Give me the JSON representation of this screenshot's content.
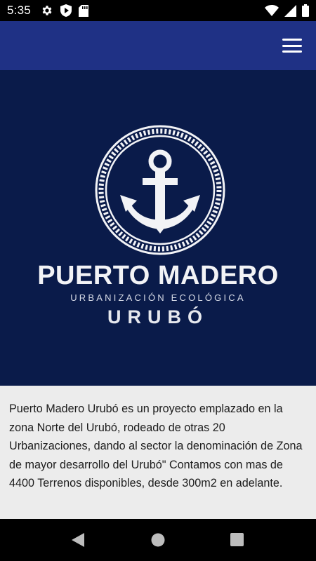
{
  "status_bar": {
    "time": "5:35",
    "left_icons": [
      "gear-icon",
      "play-protect-icon",
      "sd-card-icon"
    ],
    "right_icons": [
      "wifi-icon",
      "cell-signal-icon",
      "battery-icon"
    ]
  },
  "app_bar": {
    "menu_icon": "hamburger-menu-icon",
    "background": "#1f3185"
  },
  "hero": {
    "background": "#0a1b4a",
    "logo_icon": "anchor-icon",
    "title": "PUERTO MADERO",
    "subtitle": "URBANIZACIÓN ECOLÓGICA",
    "place": "URUBÓ"
  },
  "description": {
    "text": "Puerto Madero Urubó es un proyecto emplazado en la zona Norte del Urubó, rodeado de otras 20 Urbanizaciones, dando al sector la denominación de Zona de mayor desarrollo del Urubó\" Contamos con mas de 4400 Terrenos disponibles, desde 300m2 en adelante."
  },
  "nav_bar": {
    "icons": [
      "back-icon",
      "home-icon",
      "recents-icon"
    ]
  }
}
